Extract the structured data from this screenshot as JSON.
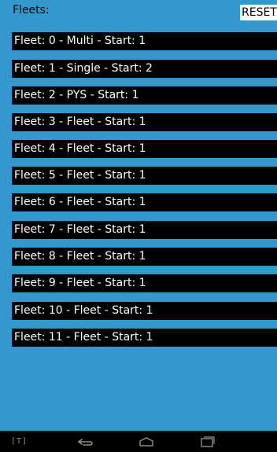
{
  "header": {
    "title": "Fleets:",
    "reset_label": "RESET"
  },
  "fleets": [
    {
      "label": "Fleet: 0 - Multi - Start: 1"
    },
    {
      "label": "Fleet: 1 - Single - Start: 2"
    },
    {
      "label": "Fleet: 2 - PYS - Start: 1"
    },
    {
      "label": "Fleet: 3 - Fleet - Start: 1"
    },
    {
      "label": "Fleet: 4 - Fleet - Start: 1"
    },
    {
      "label": "Fleet: 5 - Fleet - Start: 1"
    },
    {
      "label": "Fleet: 6 - Fleet - Start: 1"
    },
    {
      "label": "Fleet: 7 - Fleet - Start: 1"
    },
    {
      "label": "Fleet: 8 - Fleet - Start: 1"
    },
    {
      "label": "Fleet: 9 - Fleet - Start: 1"
    },
    {
      "label": "Fleet: 10 - Fleet - Start: 1"
    },
    {
      "label": "Fleet: 11 - Fleet - Start: 1"
    }
  ],
  "navbar": {
    "t_label": "[T]",
    "icons": [
      "back-icon",
      "home-icon",
      "recent-apps-icon"
    ]
  },
  "colors": {
    "background": "#3399cc",
    "row": "#000000",
    "row_text": "#ffffff"
  }
}
